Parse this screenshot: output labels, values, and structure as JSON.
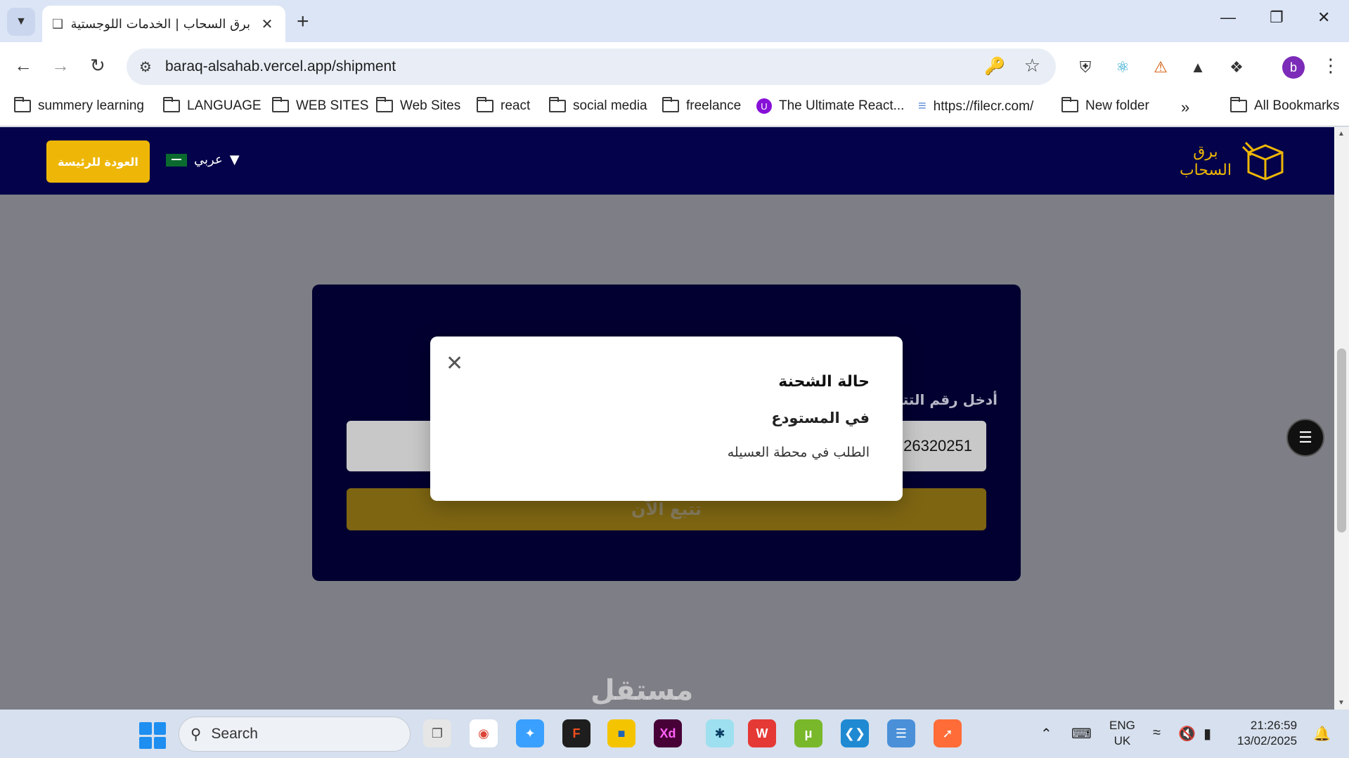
{
  "browser": {
    "tab_title": "برق السحاب | الخدمات اللوجستية",
    "url": "baraq-alsahab.vercel.app/shipment"
  },
  "bookmarks": [
    {
      "label": "summery learning",
      "icon": "folder-icon"
    },
    {
      "label": "LANGUAGE",
      "icon": "folder-icon"
    },
    {
      "label": "WEB SITES",
      "icon": "folder-icon"
    },
    {
      "label": "Web Sites",
      "icon": "folder-icon"
    },
    {
      "label": "react",
      "icon": "folder-icon"
    },
    {
      "label": "social media",
      "icon": "folder-icon"
    },
    {
      "label": "freelance",
      "icon": "folder-icon"
    },
    {
      "label": "The Ultimate React...",
      "icon": "udemy-icon"
    },
    {
      "label": "https://filecr.com/",
      "icon": "filecr-icon"
    },
    {
      "label": "New folder",
      "icon": "folder-icon"
    },
    {
      "label": "All Bookmarks",
      "icon": "folder-icon"
    }
  ],
  "site": {
    "home_button": "العودة للرئيسة",
    "language": "عربي",
    "logo_line1": "برق",
    "logo_line2": "السحاب",
    "accent_color": "#eeb707",
    "header_color": "#03024a"
  },
  "tracking": {
    "label": "أدخل رقم التتبع",
    "input_value": "26320251",
    "button_label": "تتبع الآن"
  },
  "modal": {
    "title": "حالة الشحنة",
    "status": "في المستودع",
    "description": "الطلب في محطة العسيله"
  },
  "watermark": "مستقل",
  "taskbar": {
    "search_placeholder": "Search",
    "language_line1": "ENG",
    "language_line2": "UK",
    "time": "21:26:59",
    "date": "13/02/2025"
  }
}
